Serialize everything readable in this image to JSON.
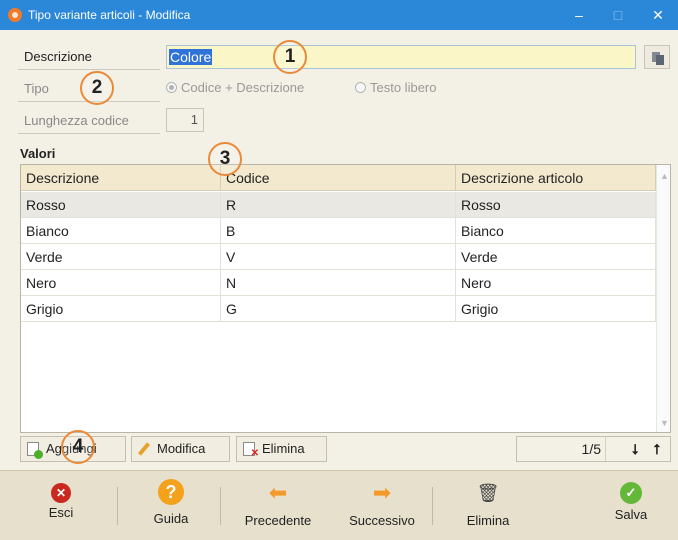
{
  "window": {
    "title": "Tipo variante articoli - Modifica",
    "minimize": "–",
    "maximize": "□",
    "close": "✕"
  },
  "form": {
    "descrizione_label": "Descrizione",
    "descrizione_value": "Colore",
    "tipo_label": "Tipo",
    "tipo_options": [
      "Codice + Descrizione",
      "Testo libero"
    ],
    "tipo_selected": "Codice + Descrizione",
    "lunghezza_label": "Lunghezza codice",
    "lunghezza_value": "1"
  },
  "values_section": {
    "title": "Valori",
    "columns": [
      "Descrizione",
      "Codice",
      "Descrizione articolo"
    ],
    "rows": [
      [
        "Rosso",
        "R",
        "Rosso"
      ],
      [
        "Bianco",
        "B",
        "Bianco"
      ],
      [
        "Verde",
        "V",
        "Verde"
      ],
      [
        "Nero",
        "N",
        "Nero"
      ],
      [
        "Grigio",
        "G",
        "Grigio"
      ]
    ],
    "selected_row": 0
  },
  "grid_actions": {
    "add": "Aggiungi",
    "edit": "Modifica",
    "delete": "Elimina"
  },
  "pager": {
    "position": "1/5",
    "down_arrow": "⭣",
    "up_arrow": "⭡"
  },
  "toolbar": {
    "exit": "Esci",
    "help": "Guida",
    "previous": "Precedente",
    "next": "Successivo",
    "delete": "Elimina",
    "save": "Salva"
  },
  "callouts": [
    "1",
    "2",
    "3",
    "4"
  ],
  "colors": {
    "titlebar": "#2b88d8",
    "accent_orange": "#e98a3a",
    "input_highlight": "#fbf6c8",
    "grid_header": "#f2e9cf"
  }
}
